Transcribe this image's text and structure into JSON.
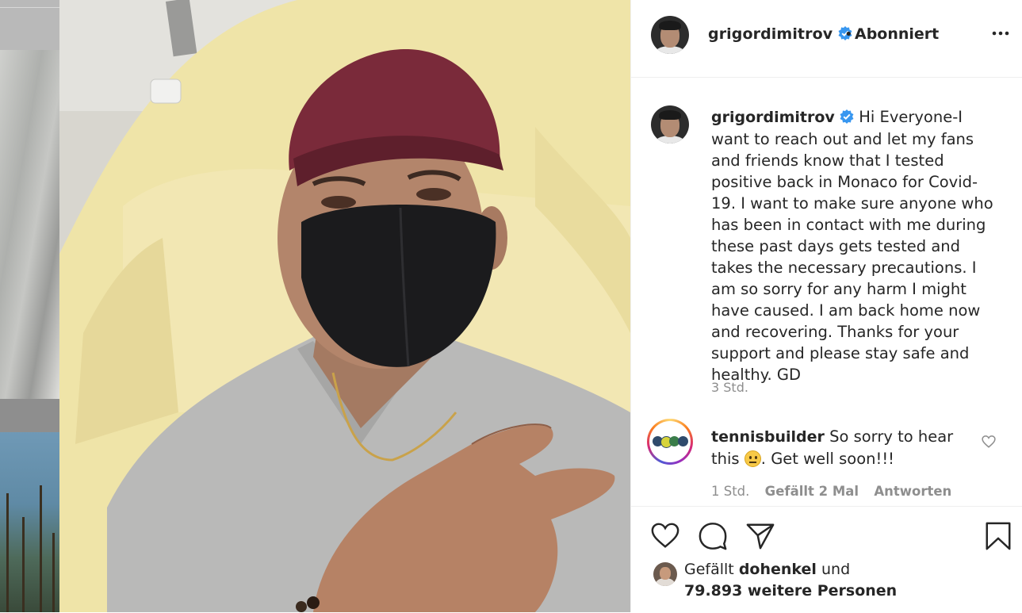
{
  "post": {
    "author": "grigordimitrov",
    "separator": "•",
    "follow_status": "Abonniert",
    "caption_author": "grigordimitrov",
    "caption_text": "Hi Everyone-I want to reach out and let my fans and friends know that I tested positive back in Monaco for Covid-19. I want to make sure anyone who has been in contact with me during these past days gets tested and takes the necessary precautions. I am so sorry for any harm I might have caused. I am back home now and recovering. Thanks for your support and please stay safe and healthy. GD",
    "time": "3 Std."
  },
  "comment": {
    "author": "tennisbuilder",
    "text_before_emoji": "So sorry to hear this",
    "text_after_emoji": ". Get well soon!!!",
    "time": "1 Std.",
    "likes": "Gefällt 2 Mal",
    "reply": "Antworten"
  },
  "likes": {
    "prefix": "Gefällt",
    "user": "dohenkel",
    "conjunction": "und",
    "others": "79.893 weitere Personen"
  },
  "icons": {
    "verified": "verified-badge-icon",
    "more": "more-options-icon",
    "like": "heart-icon",
    "comment": "comment-bubble-icon",
    "share": "paper-plane-icon",
    "save": "bookmark-icon"
  },
  "colors": {
    "verified_blue": "#3897f0",
    "muted_text": "#8e8e8e",
    "cap": "#7a2a3a",
    "mask": "#1b1b1d"
  }
}
